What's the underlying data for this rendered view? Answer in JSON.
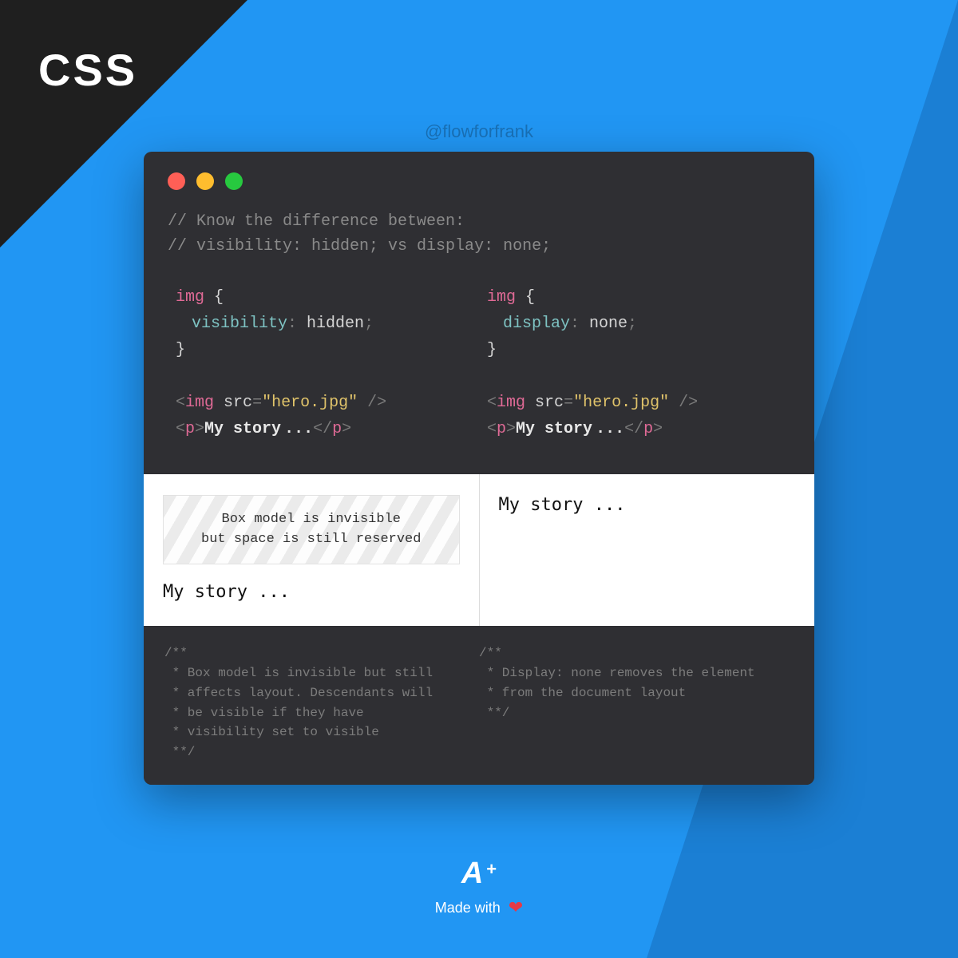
{
  "corner": {
    "label": "CSS"
  },
  "handle": "@flowforfrank",
  "comments": [
    "// Know the difference between:",
    "// visibility: hidden; vs display: none;"
  ],
  "code": {
    "open_brace": "{",
    "close_brace": "}",
    "colon_sp": ": ",
    "semicolon": ";",
    "lt": "<",
    "gt": ">",
    "lts": "</",
    "eq": "=",
    "selfclose": "/>",
    "img_tag": "img",
    "p_tag": "p",
    "src_attr": "src",
    "hero": "\"hero.jpg\"",
    "story_text": "My story ...",
    "left": {
      "selector": "img",
      "prop": "visibility",
      "val": "hidden"
    },
    "right": {
      "selector": "img",
      "prop": "display",
      "val": "none"
    }
  },
  "demo": {
    "placeholder": [
      "Box model is invisible",
      "but space is still reserved"
    ],
    "story": "My story ..."
  },
  "footnotes": {
    "left": "/**\n * Box model is invisible but still\n * affects layout. Descendants will\n * be visible if they have\n * visibility set to visible\n **/",
    "right": "/**\n * Display: none removes the element\n * from the document layout\n **/"
  },
  "footer": {
    "logo_a": "A",
    "logo_plus": "+",
    "made": "Made with",
    "heart": "❤"
  }
}
